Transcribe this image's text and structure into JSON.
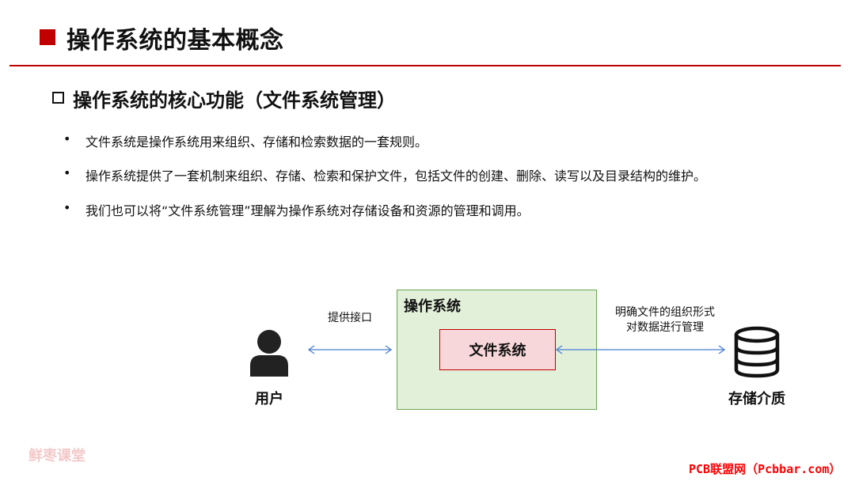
{
  "header": {
    "title": "操作系统的基本概念"
  },
  "section": {
    "subtitle": "操作系统的核心功能（文件系统管理）",
    "bullet_symbol": "•",
    "bullets": [
      "文件系统是操作系统用来组织、存储和检索数据的一套规则。",
      "操作系统提供了一套机制来组织、存储、检索和保护文件，包括文件的创建、删除、读写以及目录结构的维护。",
      "我们也可以将“文件系统管理”理解为操作系统对存储设备和资源的管理和调用。"
    ]
  },
  "diagram": {
    "user_label": "用户",
    "interface_label": "提供接口",
    "os_label": "操作系统",
    "fs_label": "文件系统",
    "right_label_line1": "明确文件的组织形式",
    "right_label_line2": "对数据进行管理",
    "storage_label": "存储介质",
    "icons": [
      "user-icon",
      "database-icon"
    ],
    "colors": {
      "accent": "#c00000",
      "os_box_fill": "#e2efd9",
      "os_box_border": "#6aa84f",
      "fs_box_fill": "#f8d7da",
      "arrow": "#4a7fd4"
    }
  },
  "watermarks": {
    "left": "鲜枣课堂",
    "right": "PCB联盟网（Pcbbar.com）"
  }
}
